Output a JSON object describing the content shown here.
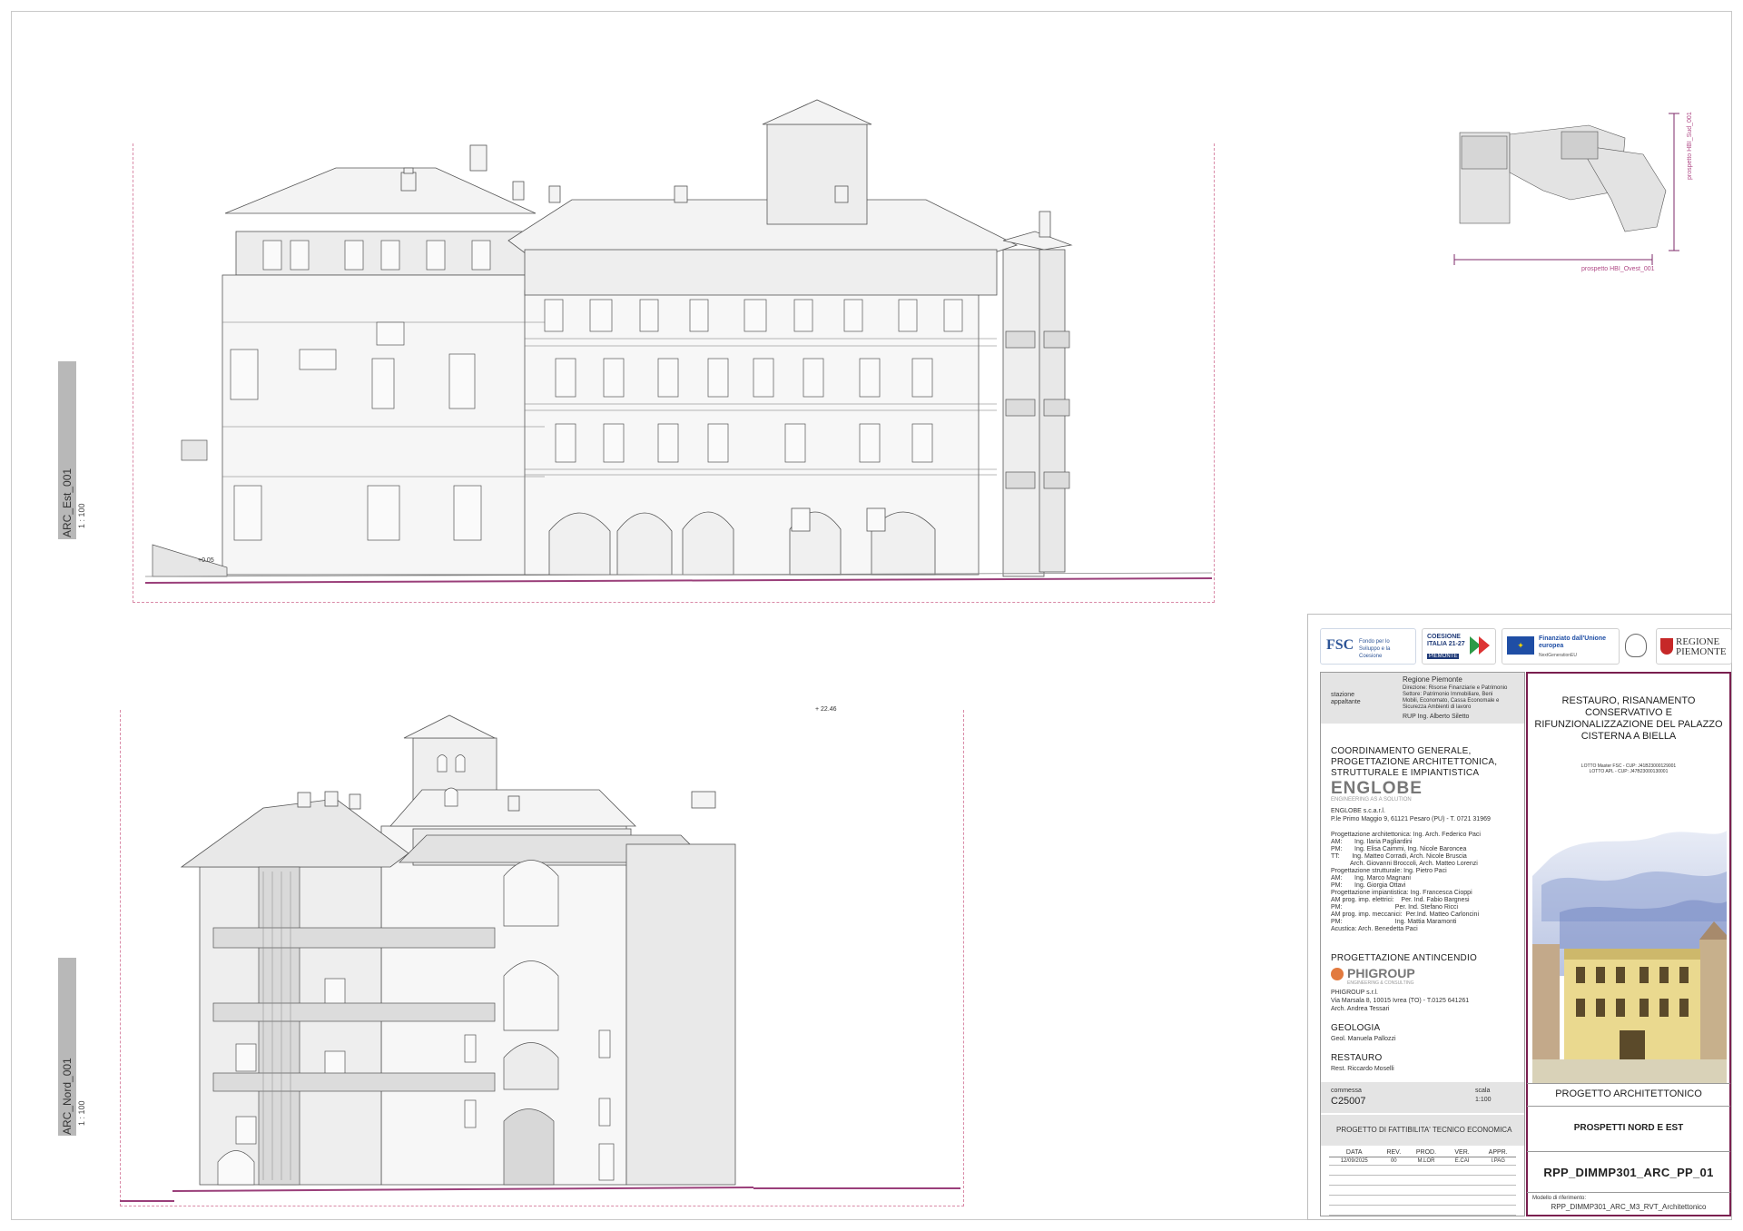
{
  "views": {
    "east": {
      "label": "ARC_Est_001",
      "scale": "1 : 100",
      "level": "+0.05"
    },
    "north": {
      "label": "ARC_Nord_001",
      "scale": "1 : 100",
      "level": "+ 22.46"
    }
  },
  "keyplan": {
    "label_ovest": "prospetto HBI_Ovest_001",
    "label_sud": "prospetto HBI_Sud_001"
  },
  "logos": {
    "fsc": "FSC",
    "fsc_sub": "Fondo per lo Sviluppo e la Coesione",
    "coesione": "COESIONE ITALIA 21-27",
    "coesione_sub": "PIEMONTE",
    "eu": "Finanziato dall'Unione europea",
    "eu_sub": "NextGenerationEU",
    "regione": "REGIONE PIEMONTE"
  },
  "stazione": {
    "label": "stazione appaltante",
    "org": "Regione Piemonte",
    "lines": [
      "Direzione: Risorse Finanziarie e Patrimonio",
      "Settore: Patrimonio Immobiliare, Beni",
      "Mobili, Economato, Cassa Economale e",
      "Sicurezza Ambienti di lavoro"
    ],
    "rup": "RUP Ing. Alberto Siletto"
  },
  "coordinamento": {
    "title": "COORDINAMENTO GENERALE, PROGETTAZIONE ARCHITETTONICA, STRUTTURALE E IMPIANTISTICA",
    "company": "ENGLOBE",
    "tagline": "ENGINEERING AS A SOLUTION",
    "company_full": "ENGLOBE s.c.a.r.l.",
    "address": "P.le Primo Maggio 9, 61121 Pesaro (PU) - T. 0721 31969",
    "team": [
      "Progettazione architettonica: Ing. Arch. Federico Paci",
      "AM:       Ing. Ilaria Pagliardini",
      "PM:       Ing. Elisa Caimmi, Ing. Nicole Baroncea",
      "TT:       Ing. Matteo Corradi, Arch. Nicole Bruscia",
      "           Arch. Giovanni Broccoli, Arch. Matteo Lorenzi",
      "Progettazione strutturale: Ing. Pietro Paci",
      "AM:       Ing. Marco Magnani",
      "PM:       Ing. Giorgia Ottavi",
      "Progettazione impiantistica: Ing. Francesca Cioppi",
      "AM prog. imp. elettrici:    Per. Ind. Fabio Bargnesi",
      "PM:                              Per. Ind. Stefano Ricci",
      "AM prog. imp. meccanici:  Per.Ind. Matteo Carloncini",
      "PM:                              Ing. Mattia Maramonti",
      "Acustica: Arch. Benedetta Paci"
    ]
  },
  "antincendio": {
    "title": "PROGETTAZIONE ANTINCENDIO",
    "company": "PHIGROUP",
    "tagline": "ENGINEERING & CONSULTING",
    "company_full": "PHIGROUP s.r.l.",
    "address": "Via Marsala 8, 10015 Ivrea (TO) - T.0125 641261",
    "person": "Arch. Andrea Tessari"
  },
  "geologia": {
    "title": "GEOLOGIA",
    "person": "Geol. Manuela Pallozzi"
  },
  "restauro": {
    "title": "RESTAURO",
    "person": "Rest. Riccardo Moselli"
  },
  "commessa": {
    "label": "commessa",
    "value": "C25007",
    "scale_label": "scala",
    "scale_value": "1:100"
  },
  "fase": "PROGETTO DI FATTIBILITA' TECNICO ECONOMICA",
  "revisions": {
    "headers": [
      "DATA",
      "REV.",
      "PROD.",
      "VER.",
      "APPR."
    ],
    "rows": [
      [
        "12/09/2025",
        "00",
        "M.LOR",
        "E.CAI",
        "I.PAG"
      ]
    ]
  },
  "project": {
    "title": "RESTAURO, RISANAMENTO CONSERVATIVO E RIFUNZIONALIZZAZIONE DEL PALAZZO CISTERNA A BIELLA",
    "lotto1": "LOTTO Master FSC - CUP: J41B23000129001",
    "lotto2": "LOTTO APL - CUP: J47B23000130001",
    "section": "PROGETTO ARCHITETTONICO",
    "drawing": "PROSPETTI NORD E EST",
    "code": "RPP_DIMMP301_ARC_PP_01",
    "model_label": "Modello di riferimento:",
    "model": "RPP_DIMMP301_ARC_M3_RVT_Architettonico"
  }
}
